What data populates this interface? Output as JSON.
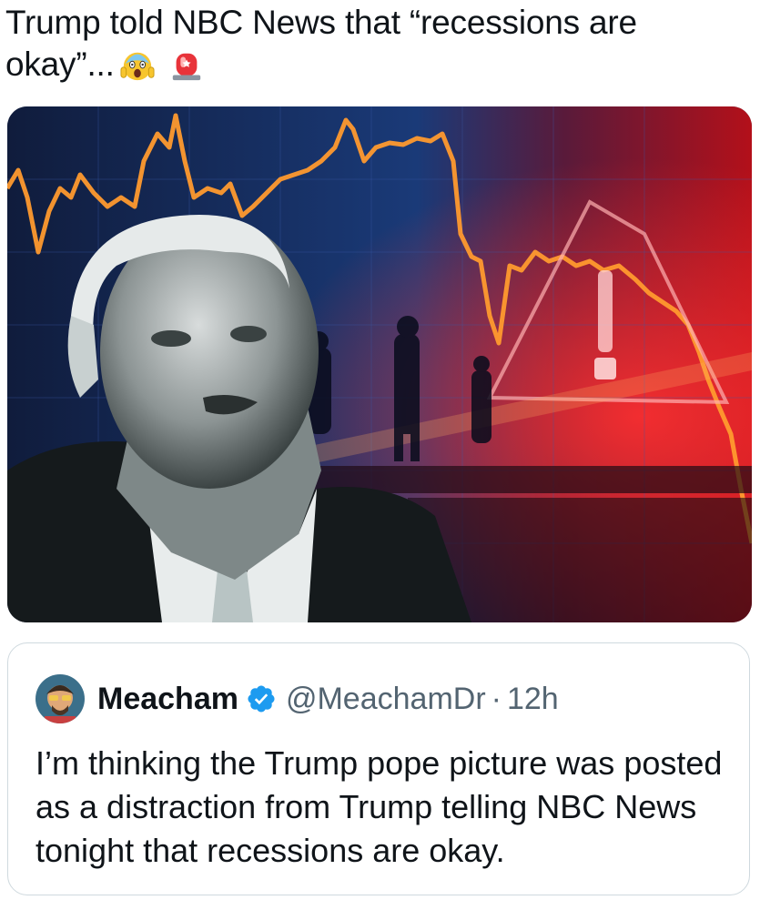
{
  "post": {
    "text": "Trump told NBC News that “recessions are okay”...",
    "emojis": [
      "face-screaming-in-fear-icon",
      "police-siren-icon"
    ]
  },
  "media": {
    "description_icon": "photo",
    "colors": {
      "background": "#0c1a3a",
      "trend_line": "#ff9a2e",
      "alert": "#ff2a2a"
    }
  },
  "quote": {
    "name": "Meacham",
    "handle": "@MeachamDr",
    "separator": "·",
    "time": "12h",
    "text": "I’m thinking the Trump pope picture was posted as a distraction from Trump telling NBC News tonight that recessions are okay.",
    "verified_icon": "verified-badge-icon",
    "verified_color": "#1d9bf0"
  }
}
